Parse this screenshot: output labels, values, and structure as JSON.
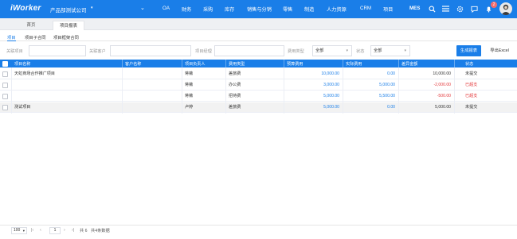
{
  "app": {
    "brand": "iWorker",
    "company": "产品部测试公司"
  },
  "nav": [
    "OA",
    "财务",
    "采购",
    "库存",
    "销售与分销",
    "零售",
    "制造",
    "人力资源",
    "CRM",
    "项目"
  ],
  "topbar": {
    "mes_label": "MES",
    "notification_count": "2"
  },
  "tabs": {
    "home": "首页",
    "project_report": "项目报表"
  },
  "subtabs": [
    "项目",
    "项目子合同",
    "项目框架合同"
  ],
  "filters": {
    "project_code": "关联项目",
    "customer": "关联客户",
    "manager": "项目经理",
    "fee_type_label": "费用类型",
    "fee_type_value": "全部",
    "status_label": "状态",
    "status_value": "全部"
  },
  "buttons": {
    "generate": "生成报表",
    "export": "导出Excel"
  },
  "table": {
    "headers": [
      "项目名称",
      "客户名称",
      "项目负责人",
      "费用类型",
      "预算费用",
      "实际费用",
      "差异金额",
      "状态"
    ],
    "rows": [
      {
        "project": "天虹商场合作推广项目",
        "customer": "",
        "owner": "蒋薇",
        "fee_type": "差旅费",
        "budget": "10,000.00",
        "actual": "0.00",
        "diff": "10,000.00",
        "status": "未提交"
      },
      {
        "project": "",
        "customer": "",
        "owner": "蒋薇",
        "fee_type": "办公费",
        "budget": "3,000.00",
        "actual": "5,000.00",
        "diff": "-2,000.00",
        "status": "已超支"
      },
      {
        "project": "",
        "customer": "",
        "owner": "蒋薇",
        "fee_type": "招待费",
        "budget": "5,000.00",
        "actual": "5,500.00",
        "diff": "-500.00",
        "status": "已超支"
      },
      {
        "project": "测试项目",
        "customer": "",
        "owner": "卢婷",
        "fee_type": "差旅费",
        "budget": "5,000.00",
        "actual": "0.00",
        "diff": "5,000.00",
        "status": "未提交"
      }
    ]
  },
  "pager": {
    "page_size": "100",
    "page": "1",
    "of_label": "共 6",
    "total": "共4条数据"
  },
  "colors": {
    "primary": "#1a7ee8",
    "danger": "#e4393c"
  }
}
